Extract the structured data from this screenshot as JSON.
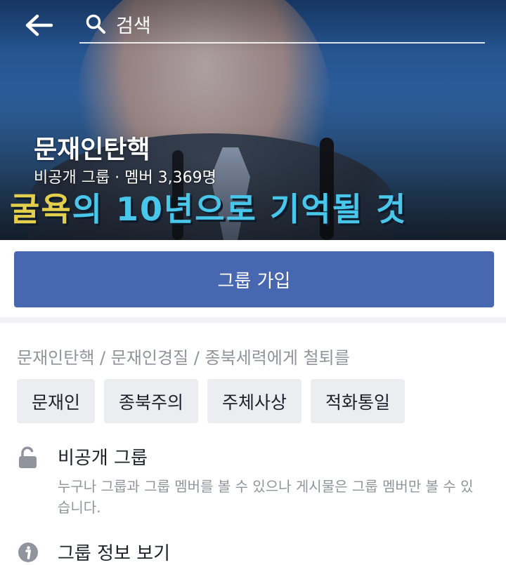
{
  "header": {
    "search_placeholder": "검색",
    "back_icon": "arrow-left-icon",
    "search_icon": "search-icon"
  },
  "cover": {
    "caption_part1": "굴욕",
    "caption_part2": "의 10년으로 기억될 ",
    "caption_part3": "것"
  },
  "group": {
    "name": "문재인탄핵",
    "meta": "비공개 그룹 · 멤버 3,369명"
  },
  "join": {
    "label": "그룹 가입"
  },
  "description": "문재인탄핵 / 문재인경질 / 종북세력에게 철퇴를",
  "tags": [
    "문재인",
    "종북주의",
    "주체사상",
    "적화통일"
  ],
  "privacy": {
    "icon": "unlock-icon",
    "title": "비공개 그룹",
    "text": "누구나 그룹과 그룹 멤버를 볼 수 있으나 게시물은 그룹 멤버만 볼 수 있습니다."
  },
  "about": {
    "icon": "info-icon",
    "title": "그룹 정보 보기"
  },
  "colors": {
    "primary": "#4767b1",
    "muted_text": "#90949c",
    "tag_bg": "#ebedf0",
    "caption_cyan": "#48c7ea",
    "caption_yellow": "#e3cf4d"
  }
}
